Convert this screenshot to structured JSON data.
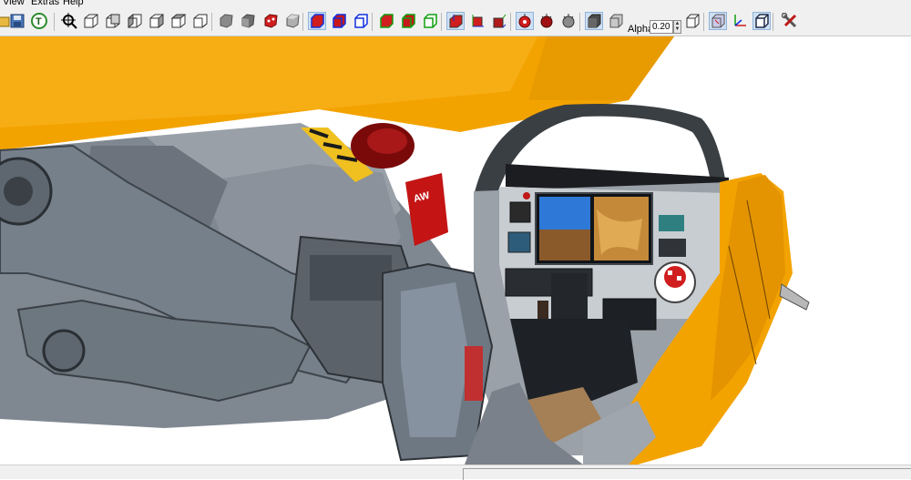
{
  "menu": {
    "items": [
      {
        "label": "View"
      },
      {
        "label": "Extras"
      },
      {
        "label": "Help"
      }
    ]
  },
  "toolbar": {
    "alpha_label": "Alpha:",
    "alpha_value": "0.20"
  },
  "viewport": {
    "scene": {
      "fuselage_color": "#f3a300",
      "cockpit_frame_color": "#3a3f44",
      "background_color": "#ffffff",
      "placard_text": "AW"
    }
  }
}
